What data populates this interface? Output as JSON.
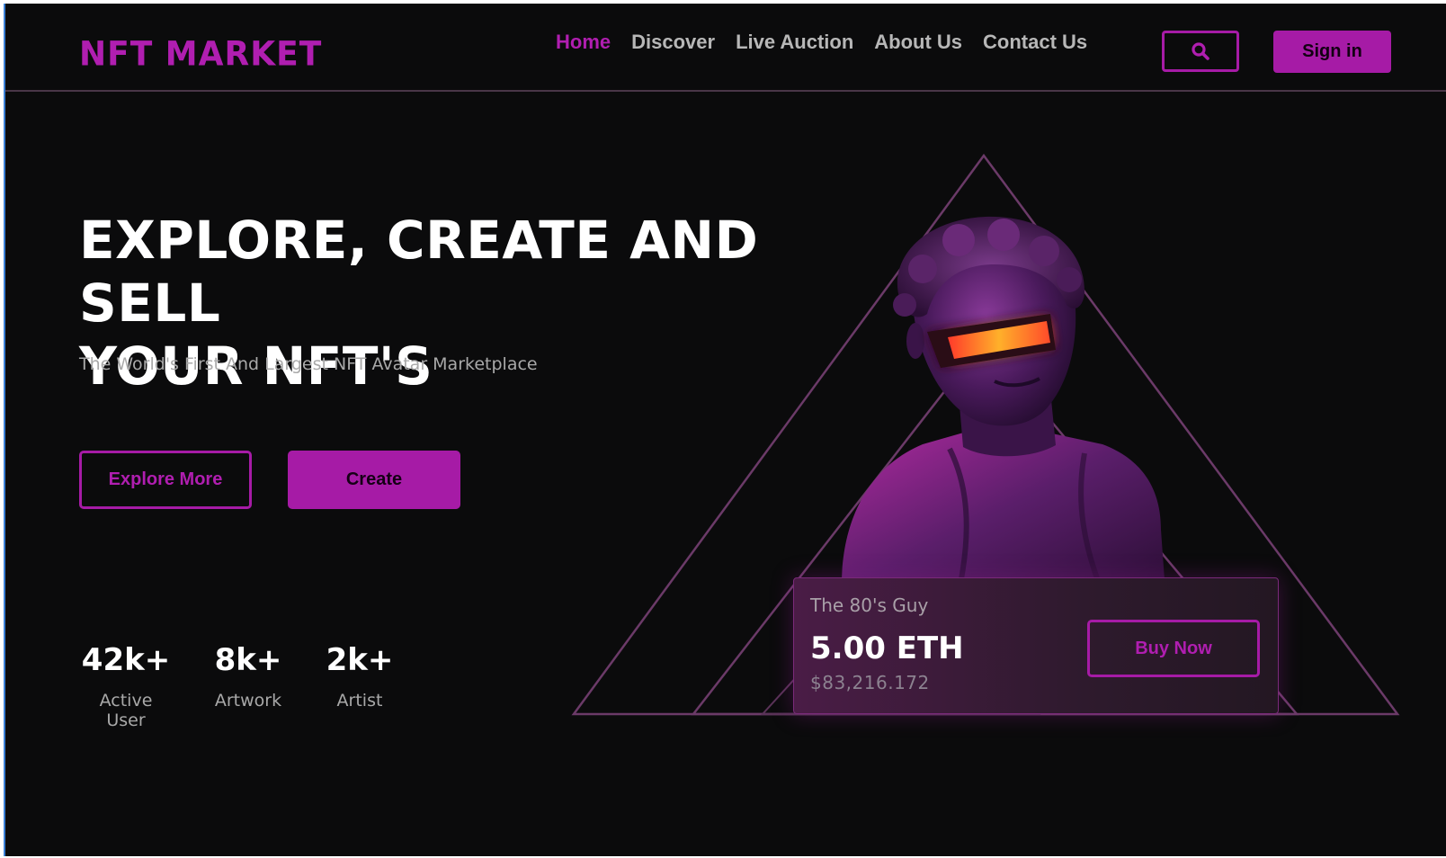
{
  "header": {
    "logo": "NFT MARKET",
    "nav": [
      {
        "label": "Home",
        "active": true
      },
      {
        "label": "Discover",
        "active": false
      },
      {
        "label": "Live Auction",
        "active": false
      },
      {
        "label": "About Us",
        "active": false
      },
      {
        "label": "Contact Us",
        "active": false
      }
    ],
    "search_icon": "search-icon",
    "signin_label": "Sign in"
  },
  "hero": {
    "title_line1": "EXPLORE, CREATE AND SELL",
    "title_line2": "YOUR NFT'S",
    "subtitle": "The World's First And Largest NFT Avatar Marketplace",
    "explore_label": "Explore More",
    "create_label": "Create"
  },
  "stats": [
    {
      "value": "42k+",
      "label": "Active User"
    },
    {
      "value": "8k+",
      "label": "Artwork"
    },
    {
      "value": "2k+",
      "label": "Artist"
    }
  ],
  "featured": {
    "name": "The 80's Guy",
    "price": "5.00 ETH",
    "usd": "$83,216.172",
    "buy_label": "Buy Now"
  },
  "colors": {
    "accent": "#a61ba6",
    "background": "#0b0b0c",
    "text": "#ffffff",
    "muted": "#a9a9a9"
  }
}
